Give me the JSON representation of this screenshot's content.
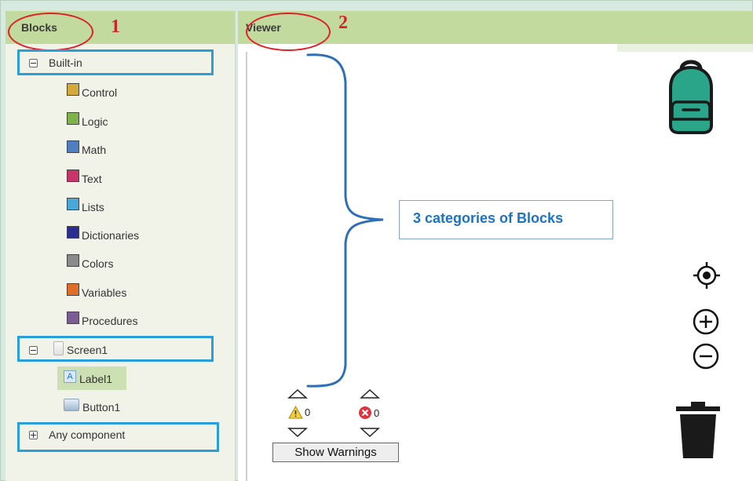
{
  "blocks_panel": {
    "title": "Blocks",
    "annotation_number": "1",
    "builtin_label": "Built-in",
    "categories": [
      {
        "label": "Control",
        "color": "#d3a93a"
      },
      {
        "label": "Logic",
        "color": "#7fb24a"
      },
      {
        "label": "Math",
        "color": "#4f7fc1"
      },
      {
        "label": "Text",
        "color": "#c8336a"
      },
      {
        "label": "Lists",
        "color": "#4aa8d8"
      },
      {
        "label": "Dictionaries",
        "color": "#2c2e93"
      },
      {
        "label": "Colors",
        "color": "#8a8a8a"
      },
      {
        "label": "Variables",
        "color": "#e06d2a"
      },
      {
        "label": "Procedures",
        "color": "#7d5b96"
      }
    ],
    "screen_label": "Screen1",
    "components": [
      {
        "label": "Label1",
        "icon": "label-component-icon"
      },
      {
        "label": "Button1",
        "icon": "button-component-icon"
      }
    ],
    "any_component_label": "Any component"
  },
  "viewer": {
    "title": "Viewer",
    "annotation_number": "2",
    "callout_text": "3 categories of Blocks",
    "warning_count": "0",
    "error_count": "0",
    "show_warnings_label": "Show Warnings"
  },
  "colors": {
    "header_green": "#c3da9f",
    "highlight_blue": "#2a9ed8",
    "annotation_red": "#e01f26",
    "backpack_teal": "#2aa58a"
  }
}
